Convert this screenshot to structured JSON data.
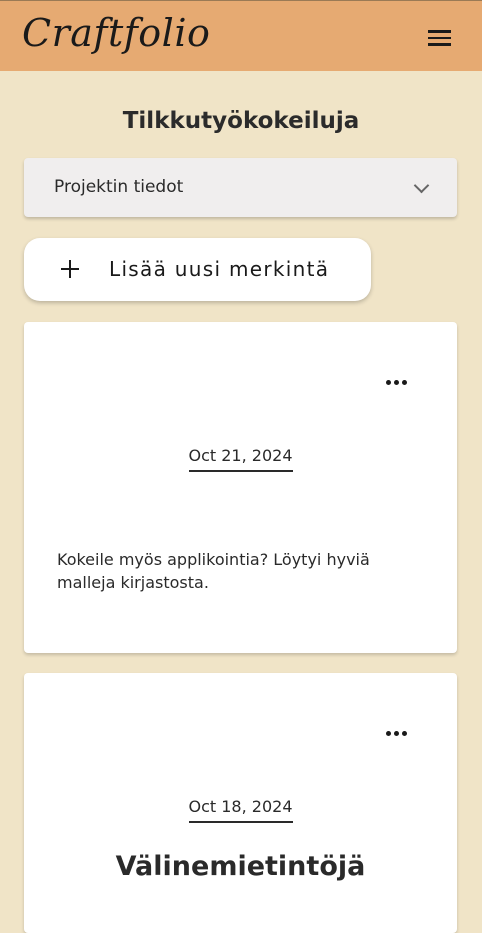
{
  "header": {
    "logo": "Craftfolio",
    "menu_icon": "hamburger-menu-icon"
  },
  "page": {
    "title": "Tilkkutyökokeiluja"
  },
  "project_details": {
    "label": "Projektin tiedot",
    "expanded": false
  },
  "add_entry": {
    "label": "Lisää uusi merkintä",
    "icon": "plus-icon"
  },
  "entries": [
    {
      "date": "Oct 21, 2024",
      "text": "Kokeile myös applikointia? Löytyi hyviä malleja kirjastosta."
    },
    {
      "date": "Oct 18, 2024",
      "title": "Välinemietintöjä"
    }
  ],
  "colors": {
    "header_bg": "#e6aa72",
    "page_bg": "#f0e4c7",
    "card_bg": "#ffffff"
  }
}
